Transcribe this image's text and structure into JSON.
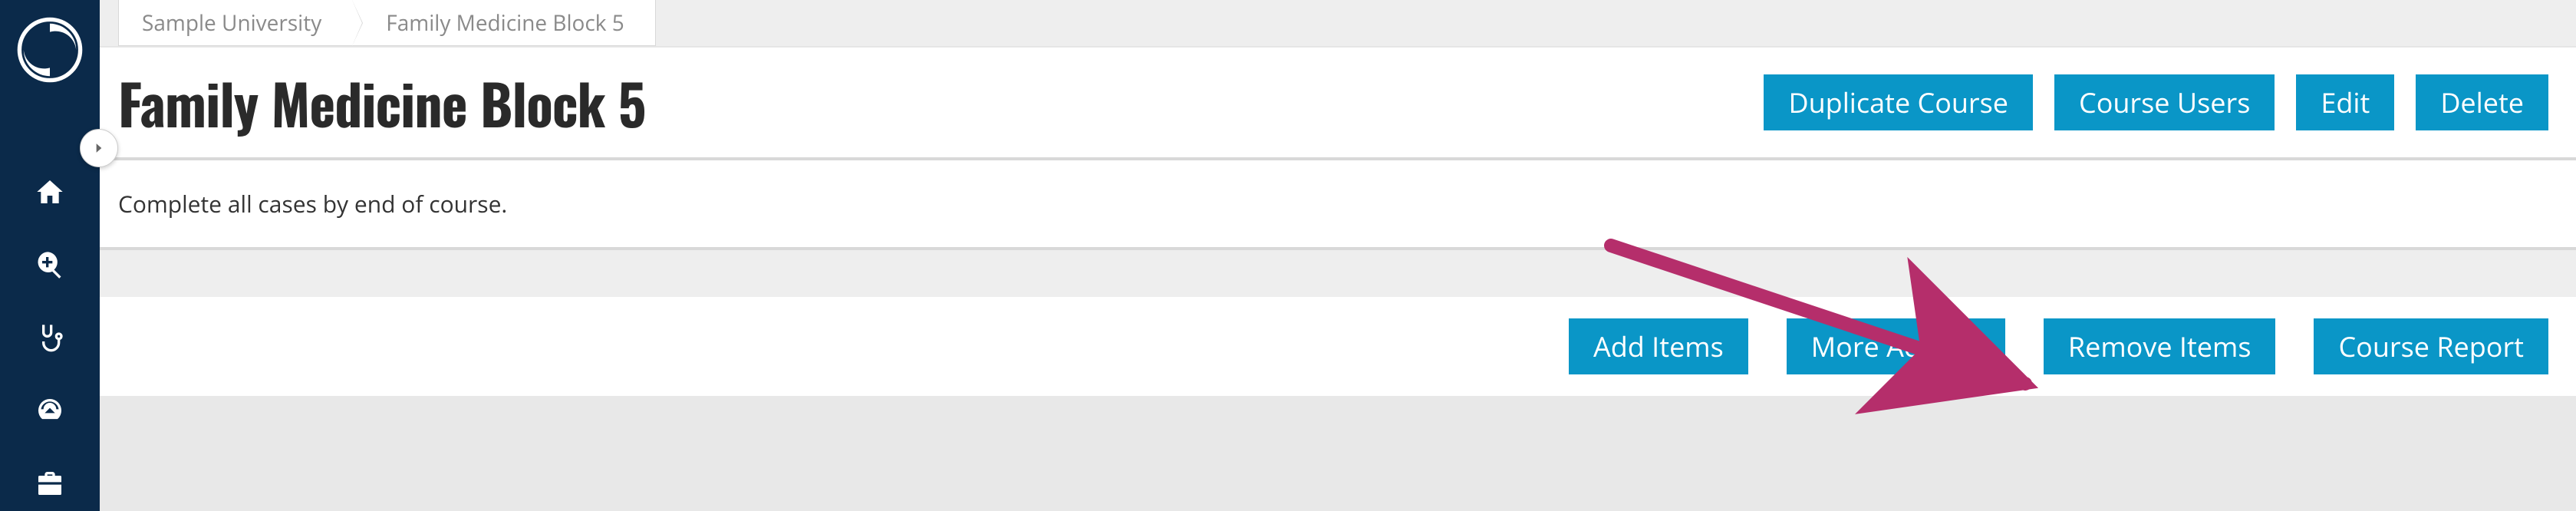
{
  "breadcrumb": {
    "items": [
      {
        "label": "Sample University"
      },
      {
        "label": "Family Medicine Block 5"
      }
    ]
  },
  "header": {
    "title": "Family Medicine Block 5",
    "buttons": {
      "duplicate": "Duplicate Course",
      "users": "Course Users",
      "edit": "Edit",
      "delete": "Delete"
    }
  },
  "description": "Complete all cases by end of course.",
  "actions": {
    "add_items": "Add Items",
    "more_actions": "More Actions",
    "remove_items": "Remove Items",
    "course_report": "Course Report"
  },
  "sidebar": {
    "icons": [
      {
        "name": "home-icon"
      },
      {
        "name": "search-plus-icon"
      },
      {
        "name": "stethoscope-icon"
      },
      {
        "name": "dashboard-icon"
      },
      {
        "name": "briefcase-icon"
      }
    ]
  },
  "colors": {
    "sidebar_bg": "#0b2a4a",
    "button_bg": "#0a96c7",
    "arrow": "#b52e6b"
  }
}
